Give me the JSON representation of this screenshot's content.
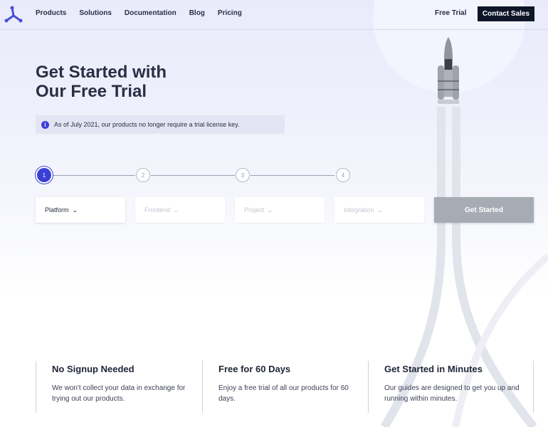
{
  "header": {
    "nav": [
      "Products",
      "Solutions",
      "Documentation",
      "Blog",
      "Pricing"
    ],
    "free_trial": "Free Trial",
    "contact_sales": "Contact Sales",
    "logo_icon": "tri-node-logo-icon",
    "brand_color": "#4a4fd6"
  },
  "hero": {
    "title_line1": "Get Started with",
    "title_line2": "Our Free Trial",
    "notice": "As of July 2021, our products no longer require a trial license key.",
    "notice_icon": "info-icon"
  },
  "stepper": {
    "steps": [
      "1",
      "2",
      "3",
      "4"
    ],
    "active_step": 1
  },
  "selects": [
    {
      "label": "Platform",
      "enabled": true
    },
    {
      "label": "Frontend",
      "enabled": false
    },
    {
      "label": "Project",
      "enabled": false
    },
    {
      "label": "Integration",
      "enabled": false
    }
  ],
  "get_started": "Get Started",
  "features": [
    {
      "title": "No Signup Needed",
      "text": "We won't collect your data in exchange for trying out our products."
    },
    {
      "title": "Free for 60 Days",
      "text": "Enjoy a free trial of all our products for 60 days."
    },
    {
      "title": "Get Started in Minutes",
      "text": "Our guides are designed to get you up and running within minutes."
    }
  ],
  "colors": {
    "accent": "#3b3fd6",
    "dark_button": "#0e1628",
    "disabled_button": "#a7abb4"
  }
}
